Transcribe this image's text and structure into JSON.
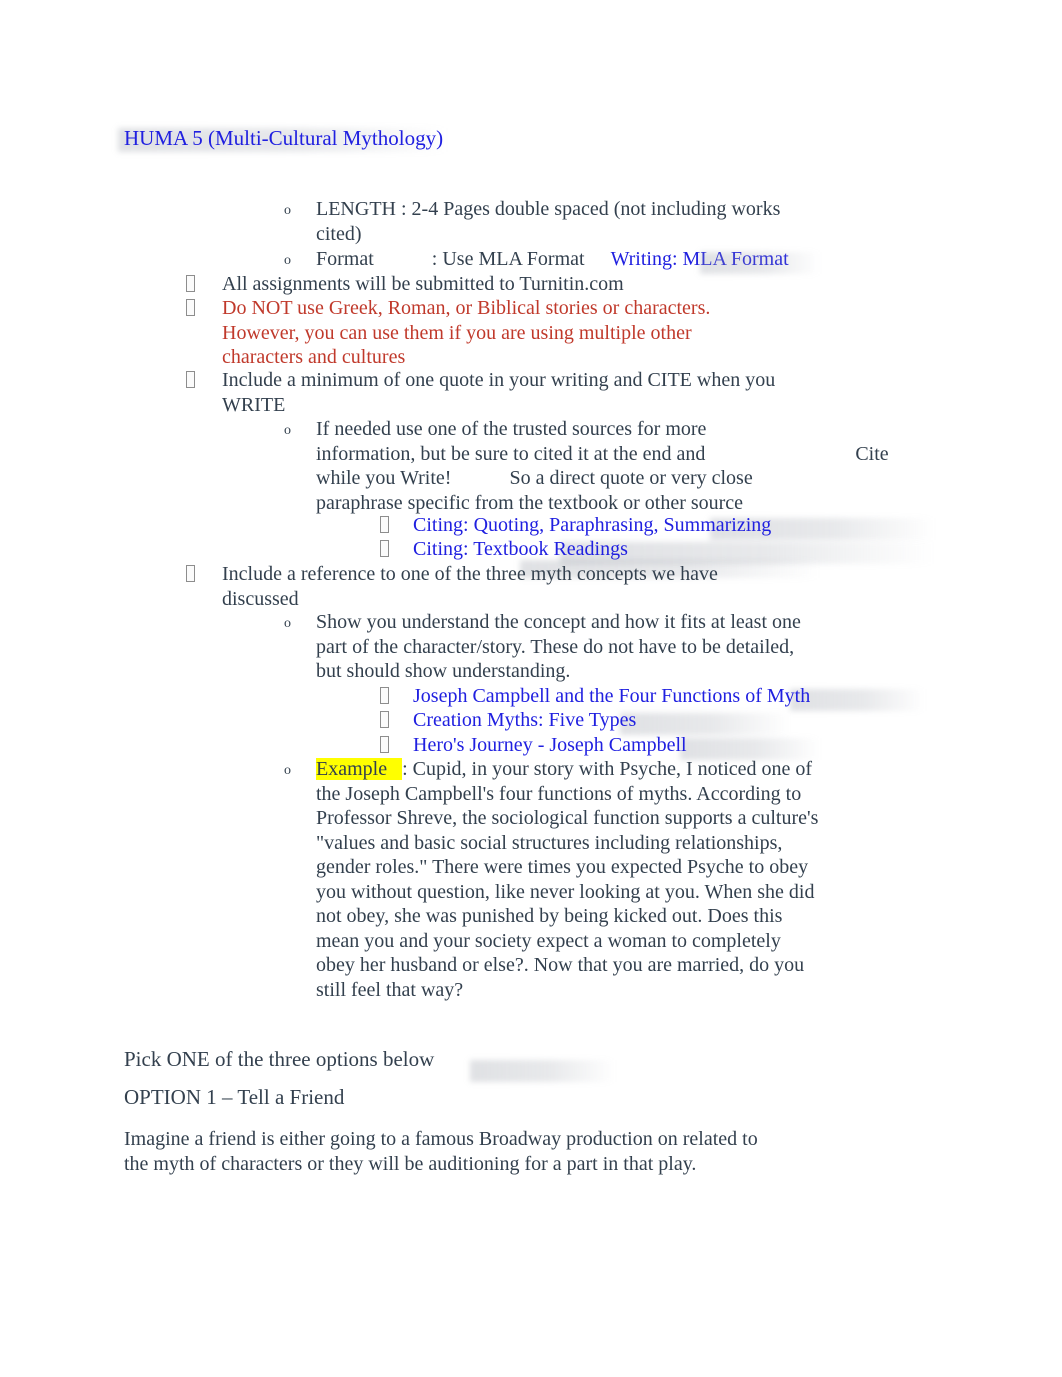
{
  "document": {
    "title": "HUMA 5 (Multi-Cultural Mythology)",
    "colors": {
      "link_blue": "#2020e0",
      "warning_red": "#c0392b",
      "body_text": "#33404e",
      "highlight_yellow": "#ffff00",
      "page_background": "#ffffff"
    }
  },
  "bullets": {
    "level1_glyph": "missing-glyph-box",
    "level2_glyph": "o",
    "level3_glyph": "missing-glyph-box"
  },
  "requirements": {
    "length": {
      "label": "LENGTH",
      "text": "LENGTH  : 2-4 Pages double spaced (not including works cited)"
    },
    "format": {
      "label": "Format",
      "separator": ": Use MLA Format",
      "link": "Writing: MLA Format"
    },
    "turnitin": "All assignments will be submitted to Turnitin.com",
    "no_greek": "Do NOT use Greek, Roman, or Biblical stories or characters. However, you can use them if you are using multiple other characters and cultures",
    "quote_cite": "Include a minimum of one quote in your writing and CITE when you WRITE",
    "trusted_sources_line1": "If needed use one of the trusted sources for more",
    "trusted_sources_line2": "information, but be sure to cited it at the end and",
    "trusted_sources_cite_word": "Cite",
    "trusted_sources_line3a": "while you Write!",
    "trusted_sources_line3b": "So a direct quote or very close",
    "trusted_sources_line4": "paraphrase specific from the textbook or other source",
    "citing_links": [
      "Citing: Quoting, Paraphrasing, Summarizing",
      "Citing: Textbook Readings"
    ],
    "myth_concept": "Include a reference to one of the three myth concepts we have discussed",
    "show_understanding": "Show you understand the concept and how it fits at least one part of the character/story. These do not have to be detailed, but should show understanding.",
    "concept_links": [
      "Joseph Campbell and the Four Functions of Myth",
      "Creation Myths: Five Types",
      "Hero's Journey - Joseph Campbell"
    ]
  },
  "example": {
    "label": "Example",
    "intro": ": Cupid, in your story with Psyche, I noticed one of the Joseph Campbell's four functions of myths.",
    "body": "According to Professor Shreve, the sociological function supports a culture's \"values and basic social structures including relationships, gender roles.\" There were times you expected Psyche to obey you without question, like never looking at you. When she did not obey, she was punished by being kicked out. Does this mean you and your society expect a woman to completely obey her husband or else?. Now that you are married, do you still feel that way?"
  },
  "options": {
    "pick_one": "Pick ONE of the three options below",
    "option1_heading": "OPTION 1 – Tell a Friend",
    "option1_body": "Imagine a friend is either going to a famous Broadway production on related to the myth of characters or they will be auditioning for a part in that play."
  }
}
